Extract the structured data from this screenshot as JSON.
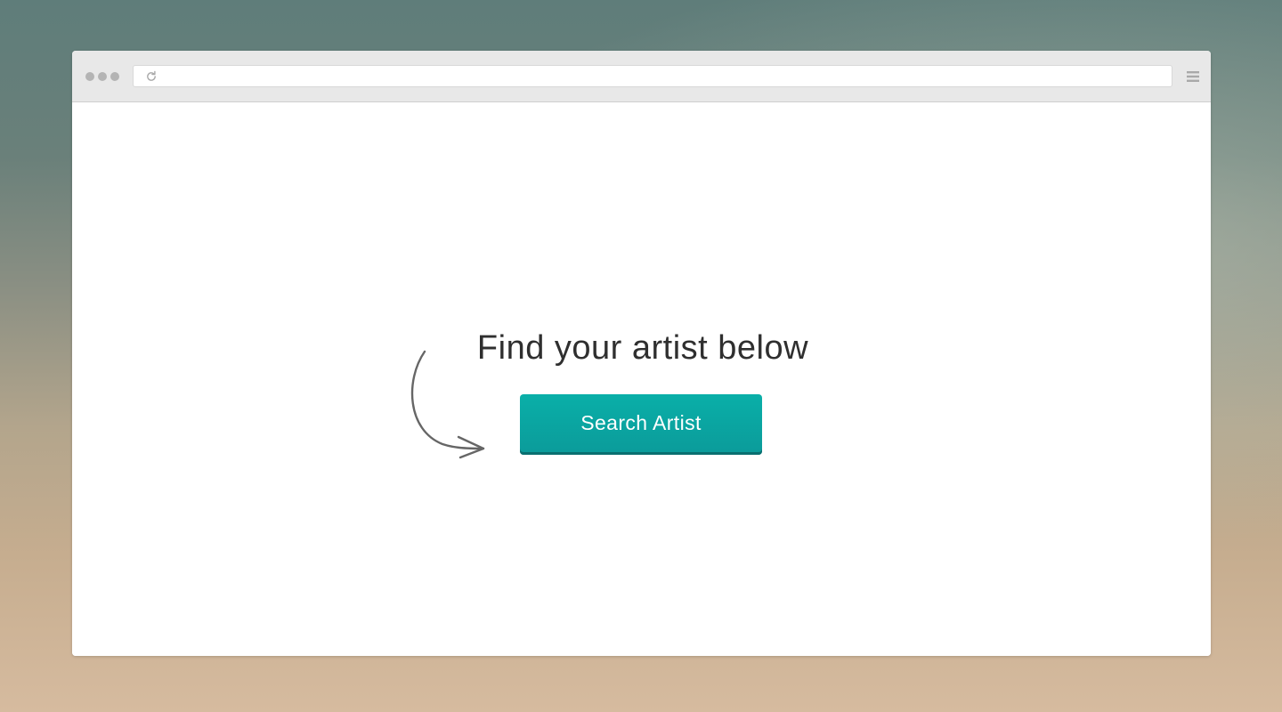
{
  "browser": {
    "address_bar": {
      "value": ""
    },
    "icons": {
      "window_controls": "window-dots-icon",
      "reload": "reload-icon",
      "menu": "hamburger-menu-icon"
    }
  },
  "main": {
    "headline": "Find your artist below",
    "search_button_label": "Search Artist",
    "decoration": "curved-arrow-icon"
  },
  "colors": {
    "accent": "#0aa9a5",
    "accent_dark": "#0a6f70",
    "text": "#2f2f2f",
    "toolbar": "#e8e8e8"
  }
}
